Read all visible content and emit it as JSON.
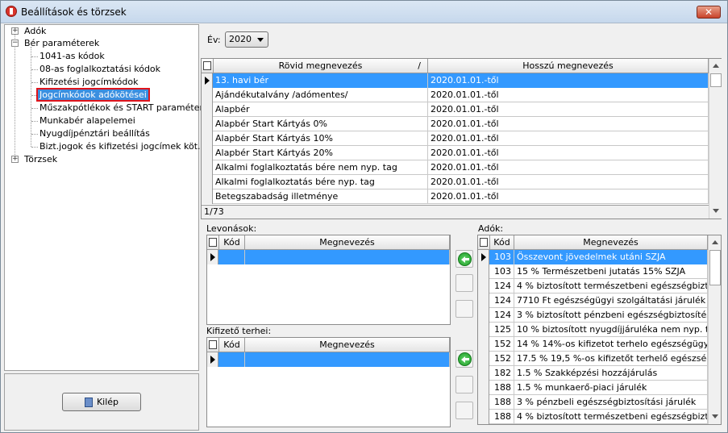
{
  "window": {
    "title": "Beállítások és törzsek",
    "close": "✕"
  },
  "tree": {
    "items": [
      {
        "label": "Adók",
        "toggle": "+"
      },
      {
        "label": "Bér paraméterek",
        "toggle": "−"
      },
      {
        "label": "1041-as kódok"
      },
      {
        "label": "08-as foglalkoztatási kódok"
      },
      {
        "label": "Kifizetési jogcímkódok"
      },
      {
        "label": "Jogcímkódok adókötései"
      },
      {
        "label": "Műszakpótlékok és START paraméterek"
      },
      {
        "label": "Munkabér alapelemei"
      },
      {
        "label": "Nyugdíjpénztári beállítás"
      },
      {
        "label": "Bizt.jogok és kifizetési jogcímek köt."
      },
      {
        "label": "Törzsek",
        "toggle": "+"
      }
    ]
  },
  "exit_button": "Kilép",
  "year": {
    "label": "Év:",
    "value": "2020"
  },
  "main_grid": {
    "columns": [
      "Rövid megnevezés",
      "Hosszú megnevezés"
    ],
    "rows": [
      [
        "13. havi bér",
        "2020.01.01.-től"
      ],
      [
        "Ajándékutalvány /adómentes/",
        "2020.01.01.-től"
      ],
      [
        "Alapbér",
        "2020.01.01.-től"
      ],
      [
        "Alapbér Start Kártyás 0%",
        "2020.01.01.-től"
      ],
      [
        "Alapbér Start Kártyás 10%",
        "2020.01.01.-től"
      ],
      [
        "Alapbér Start Kártyás 20%",
        "2020.01.01.-től"
      ],
      [
        "Alkalmi foglalkoztatás bére nem nyp. tag",
        "2020.01.01.-től"
      ],
      [
        "Alkalmi foglalkoztatás bére nyp. tag",
        "2020.01.01.-től"
      ],
      [
        "Betegszabadság illetménye",
        "2020.01.01.-től"
      ]
    ],
    "footer": "1/73",
    "sort_mark": "/"
  },
  "levonasok": {
    "label": "Levonások:",
    "columns": [
      "Kód",
      "Megnevezés"
    ]
  },
  "kifizeto": {
    "label": "Kifizető terhei:",
    "columns": [
      "Kód",
      "Megnevezés"
    ]
  },
  "adok": {
    "label": "Adók:",
    "columns": [
      "Kód",
      "Megnevezés"
    ],
    "rows": [
      [
        "103",
        "Összevont jövedelmek utáni SZJA"
      ],
      [
        "103",
        "15 %   Természetbeni jutatás 15% SZJA"
      ],
      [
        "124",
        "4 %   biztosított természetbeni egészségbiztosítá..."
      ],
      [
        "124",
        "7710 Ft egészségügyi szolgáltatási járulék"
      ],
      [
        "124",
        "3 %   biztosított pénzbeni egészségbiztosítési jár..."
      ],
      [
        "125",
        "10 %   biztosított nyugdíjjárulékа nem nyp. tag"
      ],
      [
        "152",
        "14 %   14%-os kifizetot terhelo egészségügyi hoz..."
      ],
      [
        "152",
        "17.5 %   19,5 %-os kifizetőt terhelő egészségügyi..."
      ],
      [
        "182",
        "1.5 %   Szakképzési hozzájárulás"
      ],
      [
        "188",
        "1.5 %   munkaerő-piaci járulék"
      ],
      [
        "188",
        "3 %   pénzbeli egészségbiztosítási járulék"
      ],
      [
        "188",
        "4 %   biztosított természetbeni egészségbiztosítá..."
      ]
    ]
  },
  "colors": {
    "selection": "#3399ff",
    "highlight_border": "#e0141b"
  }
}
